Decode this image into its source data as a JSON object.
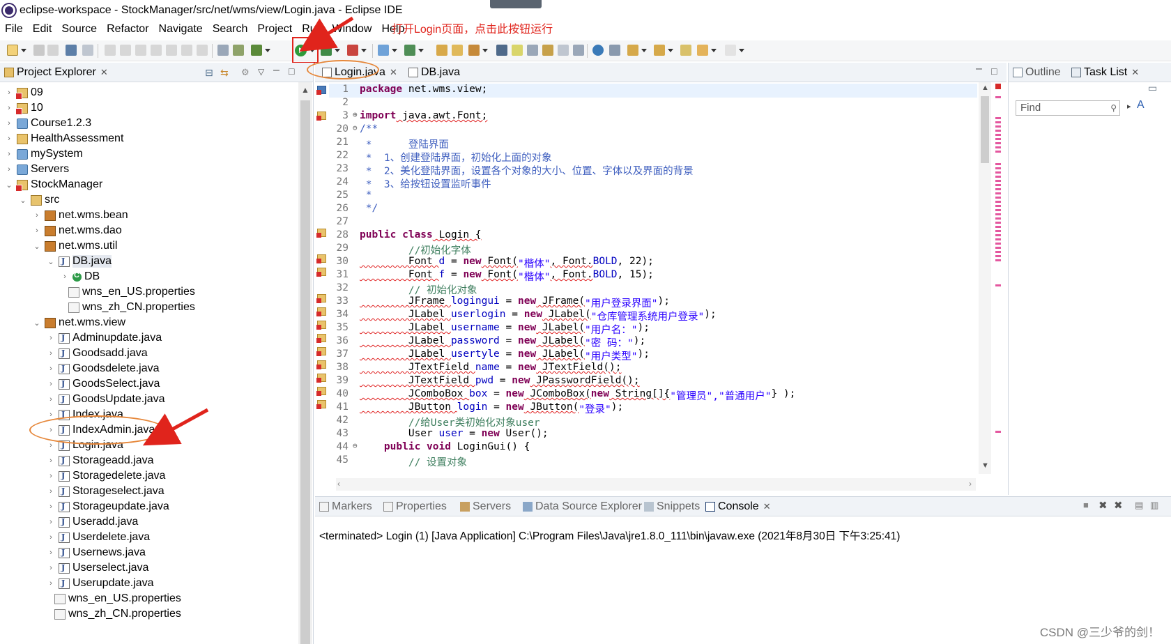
{
  "window": {
    "title": "eclipse-workspace - StockManager/src/net/wms/view/Login.java - Eclipse IDE"
  },
  "menu": [
    "File",
    "Edit",
    "Source",
    "Refactor",
    "Navigate",
    "Search",
    "Project",
    "Run",
    "Window",
    "Help"
  ],
  "annotation": {
    "text": "打开Login页面，点击此按钮运行",
    "color": "#e0241c"
  },
  "explorer": {
    "title": "Project Explorer",
    "items": [
      {
        "label": "09"
      },
      {
        "label": "10"
      },
      {
        "label": "Course1.2.3"
      },
      {
        "label": "HealthAssessment"
      },
      {
        "label": "mySystem"
      },
      {
        "label": "Servers"
      },
      {
        "label": "StockManager"
      },
      {
        "label": "src"
      },
      {
        "label": "net.wms.bean"
      },
      {
        "label": "net.wms.dao"
      },
      {
        "label": "net.wms.util"
      },
      {
        "label": "DB.java"
      },
      {
        "label": "DB"
      },
      {
        "label": "wns_en_US.properties"
      },
      {
        "label": "wns_zh_CN.properties"
      },
      {
        "label": "net.wms.view"
      },
      {
        "label": "Adminupdate.java"
      },
      {
        "label": "Goodsadd.java"
      },
      {
        "label": "Goodsdelete.java"
      },
      {
        "label": "GoodsSelect.java"
      },
      {
        "label": "GoodsUpdate.java"
      },
      {
        "label": "Index.java"
      },
      {
        "label": "IndexAdmin.java"
      },
      {
        "label": "Login.java"
      },
      {
        "label": "Storageadd.java"
      },
      {
        "label": "Storagedelete.java"
      },
      {
        "label": "Storageselect.java"
      },
      {
        "label": "Storageupdate.java"
      },
      {
        "label": "Useradd.java"
      },
      {
        "label": "Userdelete.java"
      },
      {
        "label": "Usernews.java"
      },
      {
        "label": "Userselect.java"
      },
      {
        "label": "Userupdate.java"
      },
      {
        "label": "wns_en_US.properties"
      },
      {
        "label": "wns_zh_CN.properties"
      }
    ]
  },
  "editor": {
    "tabs": [
      {
        "label": "Login.java"
      },
      {
        "label": "DB.java"
      }
    ],
    "lines": {
      "l1": {
        "n": "1",
        "kw": "package",
        "rest": " net.wms.view;"
      },
      "l2": {
        "n": "2"
      },
      "l3": {
        "n": "3",
        "kw": "import",
        "rest": " java.awt.Font;"
      },
      "l20": {
        "n": "20",
        "text": "/**"
      },
      "l21": {
        "n": "21",
        "text": " *      登陆界面"
      },
      "l22": {
        "n": "22",
        "text": " *  1、创建登陆界面，初始化上面的对象"
      },
      "l23": {
        "n": "23",
        "text": " *  2、美化登陆界面，设置各个对象的大小、位置、字体以及界面的背景"
      },
      "l24": {
        "n": "24",
        "text": " *  3、给按钮设置监听事件"
      },
      "l25": {
        "n": "25",
        "text": " *"
      },
      "l26": {
        "n": "26",
        "text": " */"
      },
      "l27": {
        "n": "27"
      },
      "l28": {
        "n": "28",
        "kw": "public class",
        "rest": " Login {"
      },
      "l29": {
        "n": "29",
        "text": "        //初始化字体"
      },
      "l30": {
        "n": "30",
        "a": "        Font ",
        "f": "d",
        "b": " = ",
        "kw": "new",
        "c": " Font(",
        "s": "\"楷体\"",
        "d": ", Font.",
        "f2": "BOLD",
        "e": ", 22);"
      },
      "l31": {
        "n": "31",
        "a": "        Font ",
        "f": "f",
        "b": " = ",
        "kw": "new",
        "c": " Font(",
        "s": "\"楷体\"",
        "d": ", Font.",
        "f2": "BOLD",
        "e": ", 15);"
      },
      "l32": {
        "n": "32",
        "text": "        // 初始化对象"
      },
      "l33": {
        "n": "33",
        "a": "        JFrame ",
        "f": "logingui",
        "b": " = ",
        "kw": "new",
        "c": " JFrame(",
        "s": "\"用户登录界面\"",
        "e": ");"
      },
      "l34": {
        "n": "34",
        "a": "        JLabel ",
        "f": "userlogin",
        "b": " = ",
        "kw": "new",
        "c": " JLabel(",
        "s": "\"仓库管理系统用户登录\"",
        "e": ");"
      },
      "l35": {
        "n": "35",
        "a": "        JLabel ",
        "f": "username",
        "b": " = ",
        "kw": "new",
        "c": " JLabel(",
        "s": "\"用户名：\"",
        "e": ");"
      },
      "l36": {
        "n": "36",
        "a": "        JLabel ",
        "f": "password",
        "b": " = ",
        "kw": "new",
        "c": " JLabel(",
        "s": "\"密 码：\"",
        "e": ");"
      },
      "l37": {
        "n": "37",
        "a": "        JLabel ",
        "f": "usertyle",
        "b": " = ",
        "kw": "new",
        "c": " JLabel(",
        "s": "\"用户类型\"",
        "e": ");"
      },
      "l38": {
        "n": "38",
        "a": "        JTextField ",
        "f": "name",
        "b": " = ",
        "kw": "new",
        "c": " JTextField();"
      },
      "l39": {
        "n": "39",
        "a": "        JTextField ",
        "f": "pwd",
        "b": " = ",
        "kw": "new",
        "c": " JPasswordField();"
      },
      "l40": {
        "n": "40",
        "a": "        JComboBox ",
        "f": "box",
        "b": " = ",
        "kw": "new",
        "c": " JComboBox(",
        "kw2": "new",
        "c2": " String[]{",
        "s": "\"管理员\",\"普通用户\"",
        "e": "} );"
      },
      "l41": {
        "n": "41",
        "a": "        JButton ",
        "f": "login",
        "b": " = ",
        "kw": "new",
        "c": " JButton(",
        "s": "\"登录\"",
        "e": ");"
      },
      "l42": {
        "n": "42",
        "text": "        //给User类初始化对象user"
      },
      "l43": {
        "n": "43",
        "a": "        User ",
        "f": "user",
        "b": " = ",
        "kw": "new",
        "c": " User();"
      },
      "l44": {
        "n": "44",
        "kw": "public void",
        "rest": " LoginGui() {"
      },
      "l45": {
        "n": "45",
        "text": "        // 设置对象"
      }
    }
  },
  "right_panel": {
    "tabs": [
      {
        "label": "Outline"
      },
      {
        "label": "Task List"
      }
    ],
    "find_placeholder": "Find",
    "link": "A"
  },
  "bottom": {
    "tabs": [
      {
        "label": "Markers"
      },
      {
        "label": "Properties"
      },
      {
        "label": "Servers"
      },
      {
        "label": "Data Source Explorer"
      },
      {
        "label": "Snippets"
      },
      {
        "label": "Console"
      }
    ],
    "console_text": "<terminated> Login (1) [Java Application] C:\\Program Files\\Java\\jre1.8.0_111\\bin\\javaw.exe (2021年8月30日 下午3:25:41)"
  },
  "watermark": "CSDN @三少爷的剑！",
  "colors": {
    "annotation_red": "#e0241c",
    "highlight_orange": "#e6873a",
    "keyword": "#7f0055",
    "comment": "#3f7f5f",
    "javadoc": "#3f5fbf",
    "string": "#2a00ff",
    "field": "#0000c0"
  }
}
